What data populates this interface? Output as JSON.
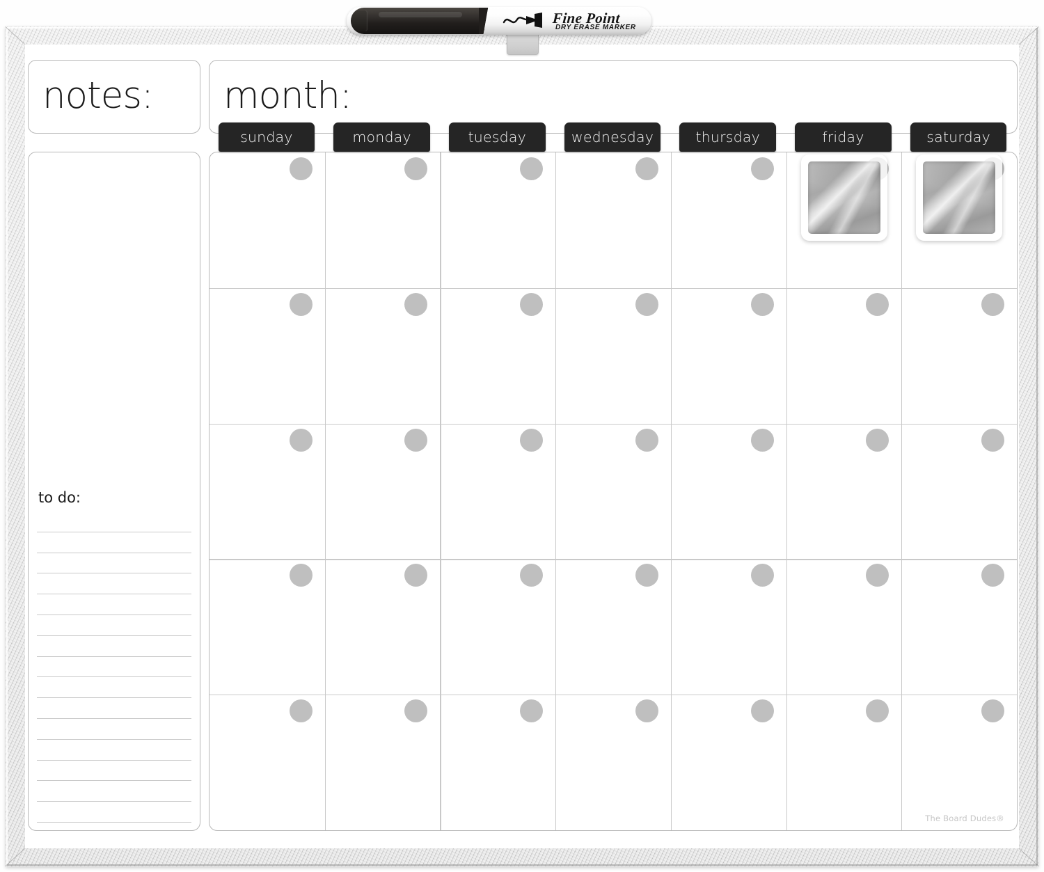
{
  "product": {
    "brand": "The Board Dudes®",
    "type": "dry-erase magnetic monthly calendar board"
  },
  "marker": {
    "name_main": "Fine Point",
    "name_sub": "DRY ERASE MARKER",
    "body_color": "#ffffff",
    "cap_color": "#211e1c"
  },
  "board": {
    "notes": {
      "label": "notes:"
    },
    "month": {
      "label": "month:"
    },
    "todo": {
      "label": "to do:",
      "line_count": 16
    },
    "day_headers": [
      "sunday",
      "monday",
      "tuesday",
      "wednesday",
      "thursday",
      "friday",
      "saturday"
    ],
    "grid": {
      "columns": 7,
      "rows": 5,
      "dots_per_row": 7
    },
    "magnets": [
      {
        "position": "row1-friday",
        "finish": "brushed-silver"
      },
      {
        "position": "row1-saturday",
        "finish": "brushed-silver"
      }
    ]
  },
  "colors": {
    "frame": "#d9d9d9",
    "day_tab_bg": "#252525",
    "day_tab_text": "#f4f4f4",
    "panel_border": "#b7b7b7",
    "grid_line": "#c9c9c9",
    "dot": "#bfbfbf",
    "brand_text": "#c6c6c6",
    "surface": "#ffffff"
  }
}
